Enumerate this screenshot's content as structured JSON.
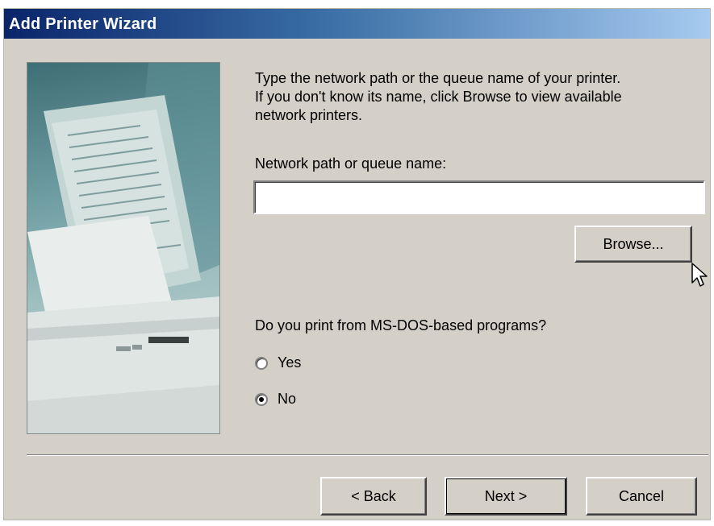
{
  "window": {
    "title": "Add Printer Wizard"
  },
  "intro_text": "Type the network path or the queue name of your printer.\nIf you don't know its name, click Browse to view available\nnetwork printers.",
  "network_path": {
    "label": "Network path or queue name:",
    "value": "",
    "placeholder": ""
  },
  "browse_button": "Browse...",
  "msdos": {
    "question": "Do you print from MS-DOS-based programs?",
    "options": [
      {
        "label": "Yes",
        "selected": false
      },
      {
        "label": "No",
        "selected": true
      }
    ]
  },
  "footer": {
    "back": "< Back",
    "next": "Next >",
    "cancel": "Cancel"
  },
  "icons": {
    "cursor": "arrow-cursor-icon",
    "radio": "radio-button-icon"
  }
}
